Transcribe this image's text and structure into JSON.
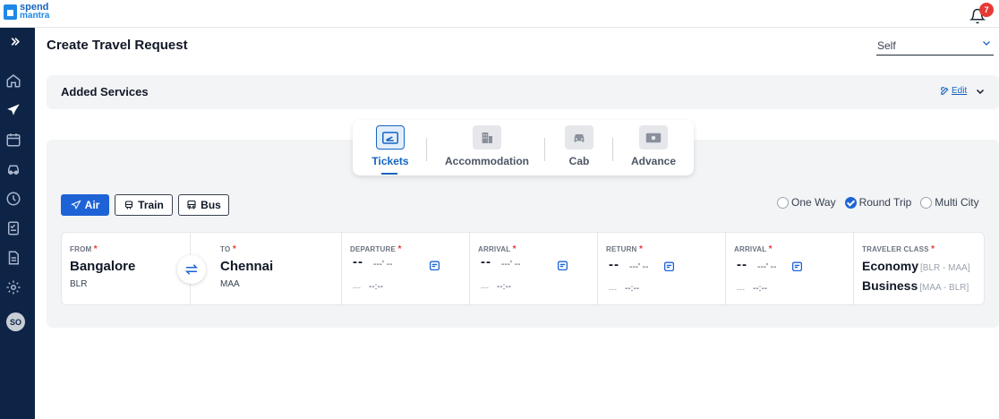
{
  "brand": {
    "line1": "spend",
    "line2": "mantra"
  },
  "notifications": {
    "count": "7"
  },
  "sidebar": {
    "expand_icon": "double-chevron-right-icon",
    "items": [
      {
        "icon": "home-icon"
      },
      {
        "icon": "airplane-icon",
        "active": true
      },
      {
        "icon": "calendar-icon"
      },
      {
        "icon": "car-icon"
      },
      {
        "icon": "history-icon"
      },
      {
        "icon": "checklist-icon"
      },
      {
        "icon": "document-icon"
      },
      {
        "icon": "gear-icon"
      }
    ],
    "avatar": "SO"
  },
  "page": {
    "title": "Create Travel Request",
    "traveler_select": "Self"
  },
  "added_services": {
    "title": "Added Services",
    "edit_label": "Edit"
  },
  "service_tabs": [
    {
      "label": "Tickets",
      "icon": "ticket-icon",
      "active": true
    },
    {
      "label": "Accommodation",
      "icon": "building-icon"
    },
    {
      "label": "Cab",
      "icon": "car-icon"
    },
    {
      "label": "Advance",
      "icon": "cash-icon"
    }
  ],
  "modes": [
    {
      "label": "Air",
      "icon": "airplane-icon",
      "active": true
    },
    {
      "label": "Train",
      "icon": "train-icon"
    },
    {
      "label": "Bus",
      "icon": "bus-icon"
    }
  ],
  "trip_types": [
    {
      "label": "One Way",
      "checked": false
    },
    {
      "label": "Round Trip",
      "checked": true
    },
    {
      "label": "Multi City",
      "checked": false
    }
  ],
  "search": {
    "from": {
      "label": "FROM",
      "city": "Bangalore",
      "code": "BLR"
    },
    "to": {
      "label": "TO",
      "city": "Chennai",
      "code": "MAA"
    },
    "departure": {
      "label": "DEPARTURE",
      "day": "--",
      "month": "---' --",
      "time_prefix": "---",
      "time": "--:--"
    },
    "arrival1": {
      "label": "ARRIVAL",
      "day": "--",
      "month": "---' --",
      "time_prefix": "---",
      "time": "--:--"
    },
    "return": {
      "label": "RETURN",
      "day": "--",
      "month": "---' --",
      "time_prefix": "---",
      "time": "--:--"
    },
    "arrival2": {
      "label": "ARRIVAL",
      "day": "--",
      "month": "---' --",
      "time_prefix": "---",
      "time": "--:--"
    },
    "traveler_class": {
      "label": "TRAVELER CLASS",
      "rows": [
        {
          "class": "Economy",
          "route": "[BLR - MAA]"
        },
        {
          "class": "Business",
          "route": "[MAA - BLR]"
        }
      ]
    },
    "required_mark": "*"
  },
  "colors": {
    "primary": "#1e63d6",
    "sidebar": "#0e2447",
    "danger": "#e53935"
  }
}
